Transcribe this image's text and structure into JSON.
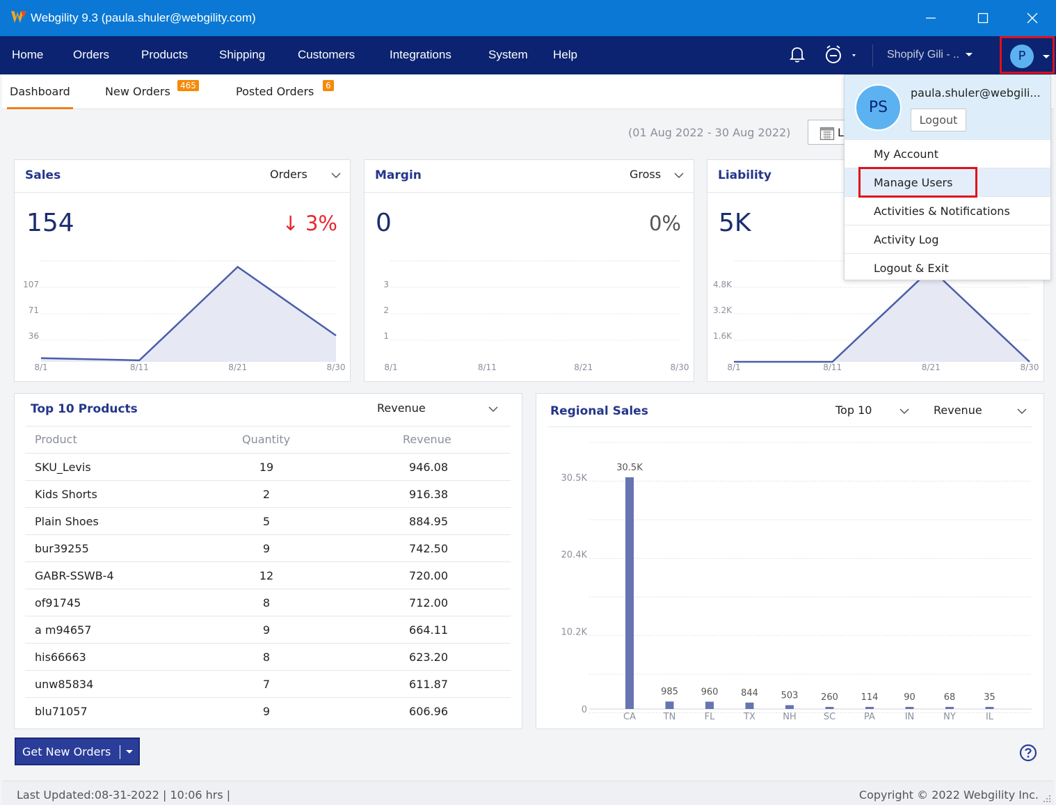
{
  "window": {
    "title": "Webgility 9.3 (paula.shuler@webgility.com)",
    "logo_letter": "W"
  },
  "nav": {
    "items": [
      "Home",
      "Orders",
      "Products",
      "Shipping",
      "Customers",
      "Integrations",
      "System",
      "Help"
    ],
    "store": "Shopify Gili - ..",
    "avatar_initial": "P"
  },
  "tabs": [
    {
      "label": "Dashboard",
      "active": true
    },
    {
      "label": "New Orders",
      "badge": "465"
    },
    {
      "label": "Posted Orders",
      "badge": "6"
    }
  ],
  "date_range": "(01 Aug 2022 - 30 Aug 2022)",
  "date_button_label": "L",
  "sales": {
    "title": "Sales",
    "dropdown": "Orders",
    "value": "154",
    "change": "↓ 3%",
    "change_color": "#e8262e"
  },
  "margin": {
    "title": "Margin",
    "dropdown": "Gross",
    "value": "0",
    "change": "0%"
  },
  "liability": {
    "title": "Liability",
    "value": "5K"
  },
  "top_products": {
    "title": "Top 10 Products",
    "dropdown": "Revenue",
    "columns": [
      "Product",
      "Quantity",
      "Revenue"
    ],
    "rows": [
      [
        "SKU_Levis",
        "19",
        "946.08"
      ],
      [
        "Kids Shorts",
        "2",
        "916.38"
      ],
      [
        "Plain Shoes",
        "5",
        "884.95"
      ],
      [
        "bur39255",
        "9",
        "742.50"
      ],
      [
        "GABR-SSWB-4",
        "12",
        "720.00"
      ],
      [
        "of91745",
        "8",
        "712.00"
      ],
      [
        "a m94657",
        "9",
        "664.11"
      ],
      [
        "his66663",
        "8",
        "623.20"
      ],
      [
        "unw85834",
        "7",
        "611.87"
      ],
      [
        "blu71057",
        "9",
        "606.96"
      ]
    ]
  },
  "regional": {
    "title": "Regional Sales",
    "dropdown_top": "Top 10",
    "dropdown_metric": "Revenue"
  },
  "get_new_orders": "Get New Orders",
  "status": {
    "last_updated": "Last Updated:08-31-2022 | 10:06 hrs |",
    "copyright": "Copyright © 2022 Webgility Inc."
  },
  "profile_menu": {
    "initials": "PS",
    "email": "paula.shuler@webgili...",
    "logout_button": "Logout",
    "items": [
      "My Account",
      "Manage Users",
      "Activities & Notifications",
      "Activity Log",
      "Logout & Exit"
    ]
  },
  "colors": {
    "titlebar": "#0a78d4",
    "navbar": "#0b2370",
    "accent_orange": "#f07d1c",
    "chart_line": "#4a5ea8",
    "highlight_red": "#e0101b"
  },
  "chart_data": [
    {
      "type": "area",
      "x": [
        "8/1",
        "8/11",
        "8/21",
        "8/30"
      ],
      "values": [
        5,
        2,
        130,
        36
      ],
      "ytick_labels": [
        "107",
        "71",
        "36"
      ],
      "ylim": [
        0,
        143
      ]
    },
    {
      "type": "line",
      "x": [
        "8/1",
        "8/11",
        "8/21",
        "8/30"
      ],
      "values": [
        0,
        0,
        0,
        0
      ],
      "ytick_labels": [
        "3",
        "2",
        "1"
      ],
      "ylim": [
        0,
        3.5
      ]
    },
    {
      "type": "area",
      "x": [
        "8/1",
        "8/11",
        "8/21",
        "8/30"
      ],
      "values": [
        0,
        0,
        5700,
        0
      ],
      "ytick_labels": [
        "4.8K",
        "3.2K",
        "1.6K"
      ],
      "ylim": [
        0,
        6400
      ]
    },
    {
      "type": "bar",
      "categories": [
        "CA",
        "TN",
        "FL",
        "TX",
        "NH",
        "SC",
        "PA",
        "IN",
        "NY",
        "IL"
      ],
      "values": [
        30500,
        985,
        960,
        844,
        503,
        260,
        114,
        90,
        68,
        35
      ],
      "data_labels": [
        "30.5K",
        "985",
        "960",
        "844",
        "503",
        "260",
        "114",
        "90",
        "68",
        "35"
      ],
      "ytick_labels": [
        "0",
        "10.2K",
        "20.4K",
        "30.5K"
      ],
      "ylim": [
        0,
        30500
      ]
    }
  ]
}
